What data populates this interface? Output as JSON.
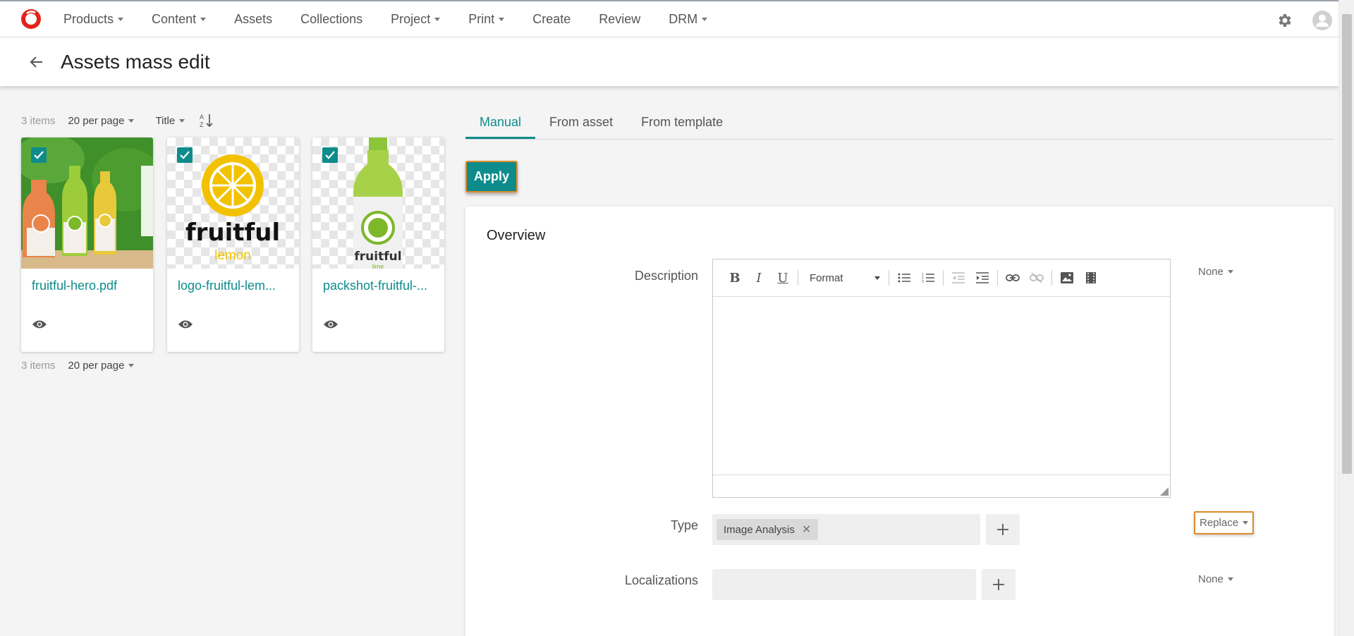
{
  "nav": {
    "items": [
      {
        "label": "Products",
        "dropdown": true
      },
      {
        "label": "Content",
        "dropdown": true
      },
      {
        "label": "Assets",
        "dropdown": false
      },
      {
        "label": "Collections",
        "dropdown": false
      },
      {
        "label": "Project",
        "dropdown": true
      },
      {
        "label": "Print",
        "dropdown": true
      },
      {
        "label": "Create",
        "dropdown": false
      },
      {
        "label": "Review",
        "dropdown": false
      },
      {
        "label": "DRM",
        "dropdown": true
      }
    ]
  },
  "header": {
    "title": "Assets mass edit"
  },
  "list": {
    "count_label": "3 items",
    "per_page_label": "20 per page",
    "sort_label": "Title",
    "cards": [
      {
        "name": "fruitful-hero.pdf",
        "checked": true,
        "thumb": "hero"
      },
      {
        "name": "logo-fruitful-lem...",
        "checked": true,
        "thumb": "logo",
        "brand": "fruitful",
        "variant": "lemon"
      },
      {
        "name": "packshot-fruitful-...",
        "checked": true,
        "thumb": "packshot",
        "brand": "fruitful",
        "variant": "lime"
      }
    ]
  },
  "tabs": [
    {
      "label": "Manual",
      "active": true
    },
    {
      "label": "From asset",
      "active": false
    },
    {
      "label": "From template",
      "active": false
    }
  ],
  "apply_label": "Apply",
  "form": {
    "section_title": "Overview",
    "description": {
      "label": "Description",
      "mode": "None",
      "format_label": "Format"
    },
    "type": {
      "label": "Type",
      "mode": "Replace",
      "tags": [
        "Image Analysis"
      ]
    },
    "localizations": {
      "label": "Localizations",
      "mode": "None"
    }
  },
  "colors": {
    "accent": "#0e8c8c",
    "highlight": "#e08a2a",
    "logo": "#e2231a"
  }
}
